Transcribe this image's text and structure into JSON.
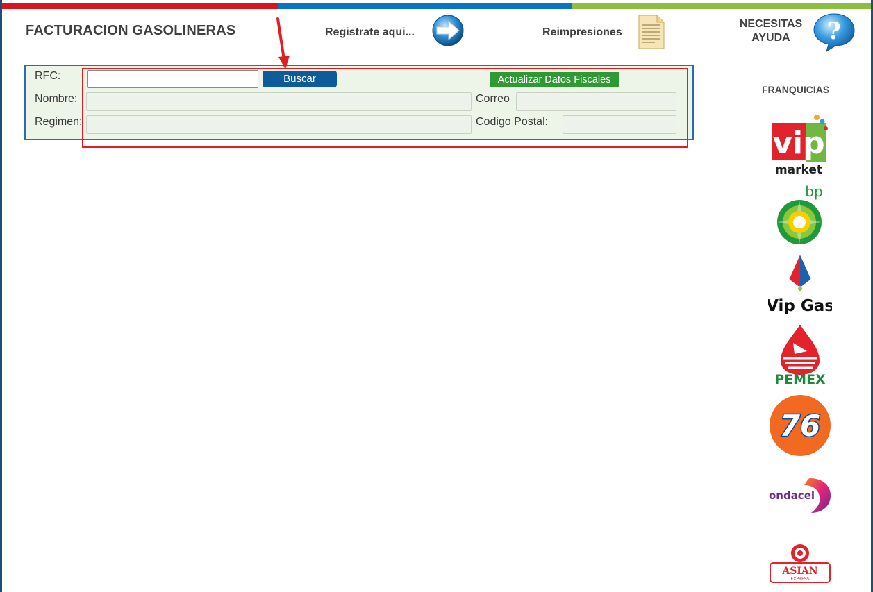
{
  "header": {
    "title": "FACTURACION GASOLINERAS",
    "register_label": "Registrate aqui...",
    "reprint_label": "Reimpresiones",
    "help_line1": "NECESITAS",
    "help_line2": "AYUDA"
  },
  "colors": {
    "bar_red": "#d9141f",
    "bar_blue": "#0a73c4",
    "bar_green": "#8cbf3f",
    "search_button": "#0d5b9b",
    "update_button": "#2f9a34",
    "annotation": "#e02020"
  },
  "form": {
    "rfc_label": "RFC:",
    "rfc_value": "",
    "search_button": "Buscar",
    "update_button": "Actualizar Datos Fiscales",
    "name_label": "Nombre:",
    "email_label": "Correo",
    "regime_label": "Regimen:",
    "postal_label": "Codigo Postal:"
  },
  "franchises": {
    "title": "FRANQUICIAS",
    "vip_market_word": "market",
    "vip_letters": "vip",
    "bp_text": "bp",
    "vipgas_text": "Vip Gas",
    "pemex_text": "PEMEX",
    "seventysix_text": "76",
    "ondacel_text": "ondacel",
    "asian_text": "ASIAN",
    "asian_sub": "EXPRESS"
  },
  "icons": [
    "arrow-right-circle-icon",
    "document-icon",
    "question-bubble-icon",
    "annotation-arrow-icon"
  ]
}
